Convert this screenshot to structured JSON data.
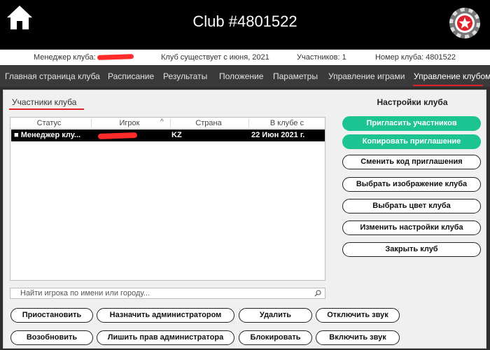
{
  "header": {
    "title": "Club #4801522"
  },
  "info": {
    "manager_label": "Менеджер клуба:",
    "since": "Клуб существует с июня, 2021",
    "members": "Участников: 1",
    "club_number": "Номер клуба: 4801522"
  },
  "nav": {
    "items": [
      "Главная страница клуба",
      "Расписание",
      "Результаты",
      "Положение",
      "Параметры",
      "Управление играми",
      "Управление клубом"
    ]
  },
  "tab": {
    "label": "Участники клуба"
  },
  "table": {
    "columns": [
      "Статус",
      "Игрок",
      "Страна",
      "В клубе с"
    ],
    "rows": [
      {
        "status": "■ Менеджер клу...",
        "country": "KZ",
        "since": "22 Июн 2021 г."
      }
    ]
  },
  "search": {
    "placeholder": "Найти игрока по имени или городу..."
  },
  "bottom_buttons": {
    "suspend": "Приостановить",
    "make_admin": "Назначить администратором",
    "delete": "Удалить",
    "mute": "Отключить звук",
    "resume": "Возобновить",
    "revoke_admin": "Лишить прав администратора",
    "block": "Блокировать",
    "unmute": "Включить звук"
  },
  "settings": {
    "title": "Настройки клуба",
    "buttons": [
      "Пригласить участников",
      "Копировать приглашение",
      "Сменить код приглашения",
      "Выбрать изображение клуба",
      "Выбрать цвет клуба",
      "Изменить настройки клуба",
      "Закрыть клуб"
    ]
  },
  "colors": {
    "accent": "#1cc491",
    "highlight": "#e0202a",
    "background": "#2e2e2e"
  }
}
